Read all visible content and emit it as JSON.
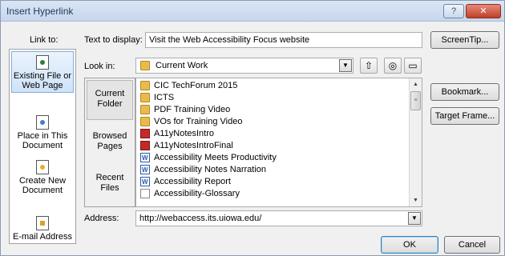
{
  "window": {
    "title": "Insert Hyperlink",
    "help_label": "?",
    "close_label": "✕"
  },
  "link_to": {
    "label": "Link to:",
    "items": [
      {
        "label": "Existing File or Web Page",
        "icon": "existing-file-icon",
        "selected": true
      },
      {
        "label": "Place in This Document",
        "icon": "place-in-document-icon",
        "selected": false
      },
      {
        "label": "Create New Document",
        "icon": "new-document-icon",
        "selected": false
      },
      {
        "label": "E-mail Address",
        "icon": "email-icon",
        "selected": false
      }
    ]
  },
  "text_display": {
    "label": "Text to display:",
    "value": "Visit the Web Accessibility Focus website"
  },
  "screentip_label": "ScreenTip...",
  "look_in": {
    "label": "Look in:",
    "value": "Current Work"
  },
  "nav": {
    "items": [
      {
        "label": "Current Folder",
        "selected": true
      },
      {
        "label": "Browsed Pages",
        "selected": false
      },
      {
        "label": "Recent Files",
        "selected": false
      }
    ]
  },
  "files": [
    {
      "name": "CIC TechForum 2015",
      "type": "folder"
    },
    {
      "name": "ICTS",
      "type": "folder"
    },
    {
      "name": "PDF Training Video",
      "type": "folder"
    },
    {
      "name": "VOs for Training Video",
      "type": "folder"
    },
    {
      "name": "A11yNotesIntro",
      "type": "pdf"
    },
    {
      "name": "A11yNotesIntroFinal",
      "type": "pdf"
    },
    {
      "name": "Accessibility Meets Productivity",
      "type": "word"
    },
    {
      "name": "Accessibility Notes Narration",
      "type": "word"
    },
    {
      "name": "Accessibility Report",
      "type": "word"
    },
    {
      "name": "Accessibility-Glossary",
      "type": "blank"
    }
  ],
  "bookmark_label": "Bookmark...",
  "target_frame_label": "Target Frame...",
  "address": {
    "label": "Address:",
    "value": "http://webaccess.its.uiowa.edu/"
  },
  "ok_label": "OK",
  "cancel_label": "Cancel"
}
